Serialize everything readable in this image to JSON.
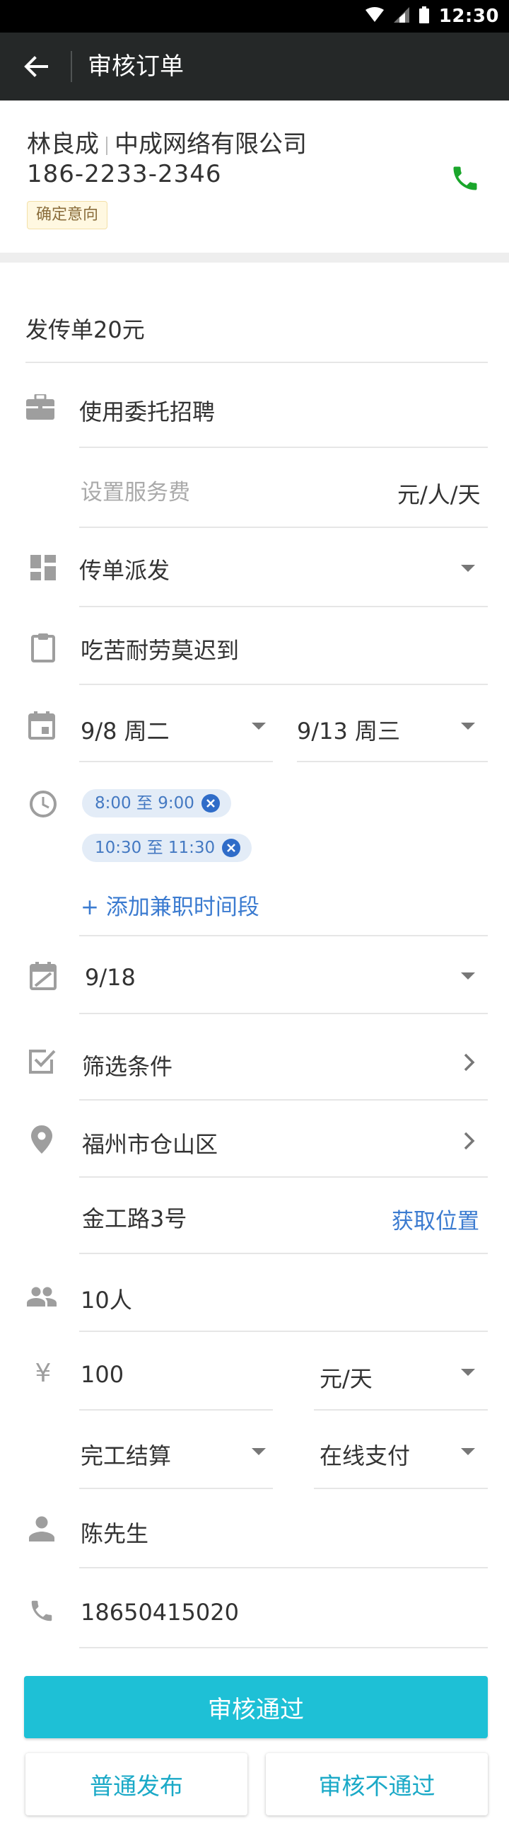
{
  "status_bar": {
    "time": "12:30",
    "icons": [
      "wifi-icon",
      "signal-icon",
      "battery-icon"
    ]
  },
  "app_bar": {
    "title": "审核订单",
    "back_icon": "arrow-back-icon"
  },
  "header": {
    "name": "林良成",
    "company": "中成网络有限公司",
    "phone": "186-2233-2346",
    "badge": "确定意向",
    "call_icon": "phone-icon"
  },
  "form": {
    "post_price": "发传单20元",
    "entrust": {
      "icon": "briefcase-icon",
      "label": "使用委托招聘"
    },
    "service_fee": {
      "placeholder": "设置服务费",
      "unit": "元/人/天"
    },
    "category": {
      "icon": "dashboard-icon",
      "value": "传单派发"
    },
    "requirement": {
      "icon": "clipboard-icon",
      "value": "吃苦耐劳莫迟到"
    },
    "date_range": {
      "icon": "calendar-icon",
      "start": "9/8  周二",
      "end": "9/13  周三"
    },
    "time_slots": {
      "icon": "clock-icon",
      "slots": [
        "8:00 至 9:00",
        "10:30 至 11:30"
      ],
      "add_label": "+ 添加兼职时间段"
    },
    "deadline": {
      "icon": "calendar-check-icon",
      "value": "9/18"
    },
    "filter": {
      "icon": "checkbox-icon",
      "label": "筛选条件"
    },
    "district": {
      "icon": "location-icon",
      "value": "福州市仓山区"
    },
    "address": {
      "value": "金工路3号",
      "action": "获取位置"
    },
    "headcount": {
      "icon": "people-icon",
      "value": "10人"
    },
    "salary": {
      "icon": "yen-icon",
      "amount": "100",
      "unit": "元/天"
    },
    "settlement": {
      "mode": "完工结算",
      "payment": "在线支付"
    },
    "contact": {
      "icon": "person-icon",
      "name": "陈先生"
    },
    "contact_phone": {
      "icon": "phone-icon",
      "value": "18650415020"
    }
  },
  "actions": {
    "approve": "审核通过",
    "normal_publish": "普通发布",
    "reject": "审核不通过"
  },
  "colors": {
    "app_bar": "#252828",
    "primary_button": "#1ec0d6",
    "secondary_text": "#1aa9c7",
    "link": "#3b7bd0",
    "call_icon": "#1aa62b",
    "chip_bg": "#e3ecf7"
  }
}
